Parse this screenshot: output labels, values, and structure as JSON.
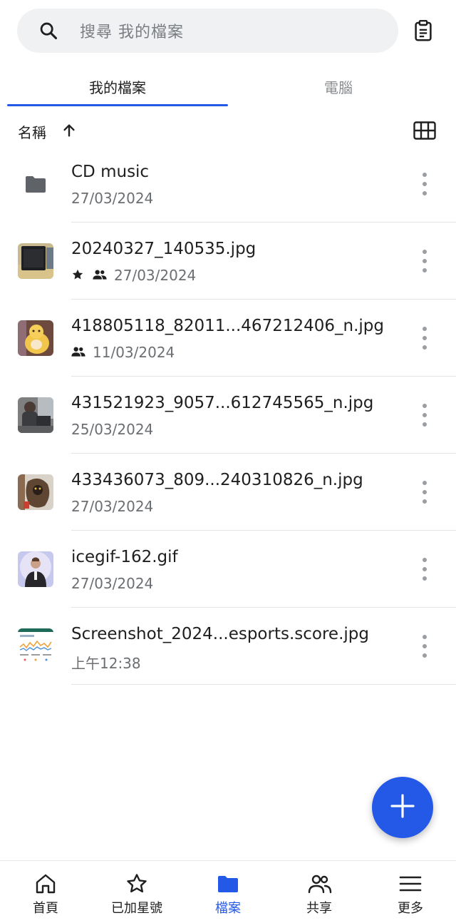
{
  "search": {
    "placeholder": "搜尋 我的檔案"
  },
  "tabs": [
    {
      "label": "我的檔案",
      "active": true
    },
    {
      "label": "電腦",
      "active": false
    }
  ],
  "sort": {
    "label": "名稱",
    "direction": "ascending"
  },
  "files": [
    {
      "name": "CD music",
      "date": "27/03/2024",
      "type": "folder",
      "starred": false,
      "shared": false
    },
    {
      "name": "20240327_140535.jpg",
      "date": "27/03/2024",
      "type": "image",
      "starred": true,
      "shared": true
    },
    {
      "name": "418805118_82011...467212406_n.jpg",
      "date": "11/03/2024",
      "type": "image",
      "starred": false,
      "shared": true
    },
    {
      "name": "431521923_9057...612745565_n.jpg",
      "date": "25/03/2024",
      "type": "image",
      "starred": false,
      "shared": false
    },
    {
      "name": "433436073_809...240310826_n.jpg",
      "date": "27/03/2024",
      "type": "image",
      "starred": false,
      "shared": false
    },
    {
      "name": "icegif-162.gif",
      "date": "27/03/2024",
      "type": "image",
      "starred": false,
      "shared": false
    },
    {
      "name": "Screenshot_2024...esports.score.jpg",
      "date": "上午12:38",
      "type": "image",
      "starred": false,
      "shared": false
    }
  ],
  "bottom_nav": [
    {
      "label": "首頁",
      "icon": "home-icon",
      "active": false
    },
    {
      "label": "已加星號",
      "icon": "star-icon",
      "active": false
    },
    {
      "label": "檔案",
      "icon": "folder-icon",
      "active": true
    },
    {
      "label": "共享",
      "icon": "people-icon",
      "active": false
    },
    {
      "label": "更多",
      "icon": "menu-icon",
      "active": false
    }
  ],
  "colors": {
    "accent": "#2459e8",
    "search_bg": "#f0f1f3",
    "muted_text": "#6b6e72"
  }
}
